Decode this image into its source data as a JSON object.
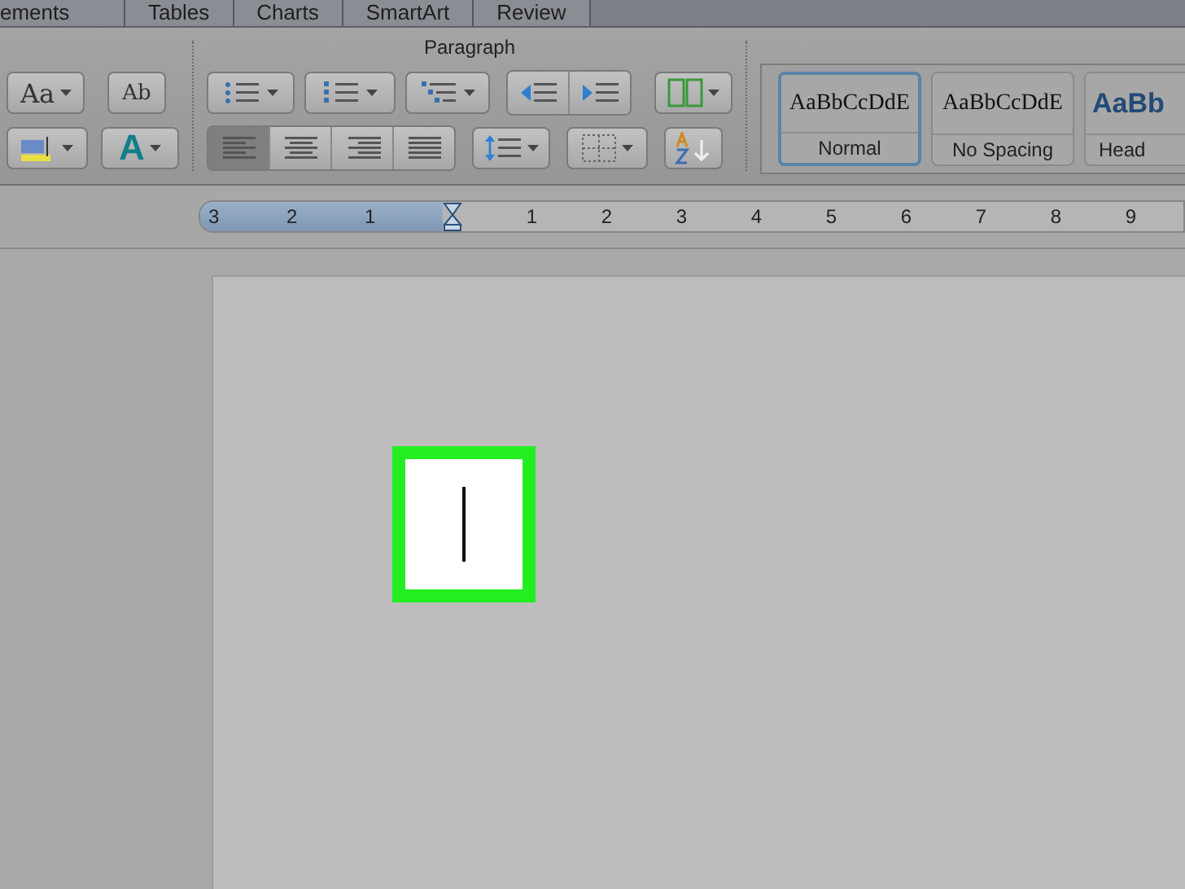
{
  "tabs": [
    {
      "label": "ements"
    },
    {
      "label": "Tables"
    },
    {
      "label": "Charts"
    },
    {
      "label": "SmartArt"
    },
    {
      "label": "Review"
    }
  ],
  "font_group": {
    "change_case_glyph": "Aa",
    "clear_format_glyph": "Ab",
    "text_effects_glyph": "A"
  },
  "paragraph": {
    "title": "Paragraph",
    "alignment": [
      {
        "kind": "left",
        "selected": true
      },
      {
        "kind": "center",
        "selected": false
      },
      {
        "kind": "right",
        "selected": false
      },
      {
        "kind": "justify",
        "selected": false
      }
    ]
  },
  "styles": [
    {
      "kind": "body",
      "sample": "AaBbCcDdE",
      "name": "Normal",
      "selected": true
    },
    {
      "kind": "body",
      "sample": "AaBbCcDdE",
      "name": "No Spacing",
      "selected": false
    },
    {
      "kind": "heading",
      "sample": "AaBb",
      "name": "Head",
      "selected": false
    }
  ],
  "ruler": {
    "left_labels": [
      "3",
      "2",
      "1"
    ],
    "right_labels": [
      "1",
      "2",
      "3",
      "4",
      "5",
      "6",
      "7",
      "8",
      "9"
    ]
  },
  "document": {
    "text_box": {
      "highlighted": true
    }
  }
}
